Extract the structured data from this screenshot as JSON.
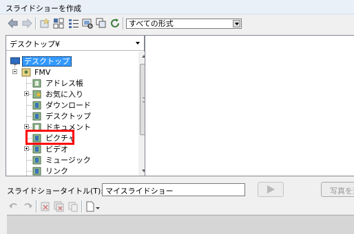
{
  "window": {
    "title": "スライドショーを作成"
  },
  "toolbar": {
    "icons": [
      "back-icon",
      "forward-icon",
      "add-folder-icon",
      "tree-view-icon",
      "list-view-icon",
      "thumbnail-view-icon",
      "copy-icon",
      "refresh-icon"
    ],
    "format_select": {
      "value": "すべての形式"
    }
  },
  "left_pane": {
    "folder_dropdown": {
      "value": "デスクトップ¥"
    },
    "tree": [
      {
        "label": "デスクトップ",
        "selected": true
      },
      {
        "label": "FMV",
        "expanded": true
      },
      {
        "label": "アドレス帳"
      },
      {
        "label": "お気に入り",
        "has_children": true
      },
      {
        "label": "ダウンロード"
      },
      {
        "label": "デスクトップ"
      },
      {
        "label": "ドキュメント",
        "has_children": true
      },
      {
        "label": "ピクチャ",
        "highlighted": true
      },
      {
        "label": "ビデオ",
        "has_children": true
      },
      {
        "label": "ミュージック"
      },
      {
        "label": "リンク"
      }
    ]
  },
  "bottom": {
    "title_label": "スライドショータイトル(T):",
    "title_value": "マイスライドショー",
    "photo_button_label": "写真を追"
  },
  "colors": {
    "highlight": "#ff0000",
    "selection": "#3399ff"
  }
}
